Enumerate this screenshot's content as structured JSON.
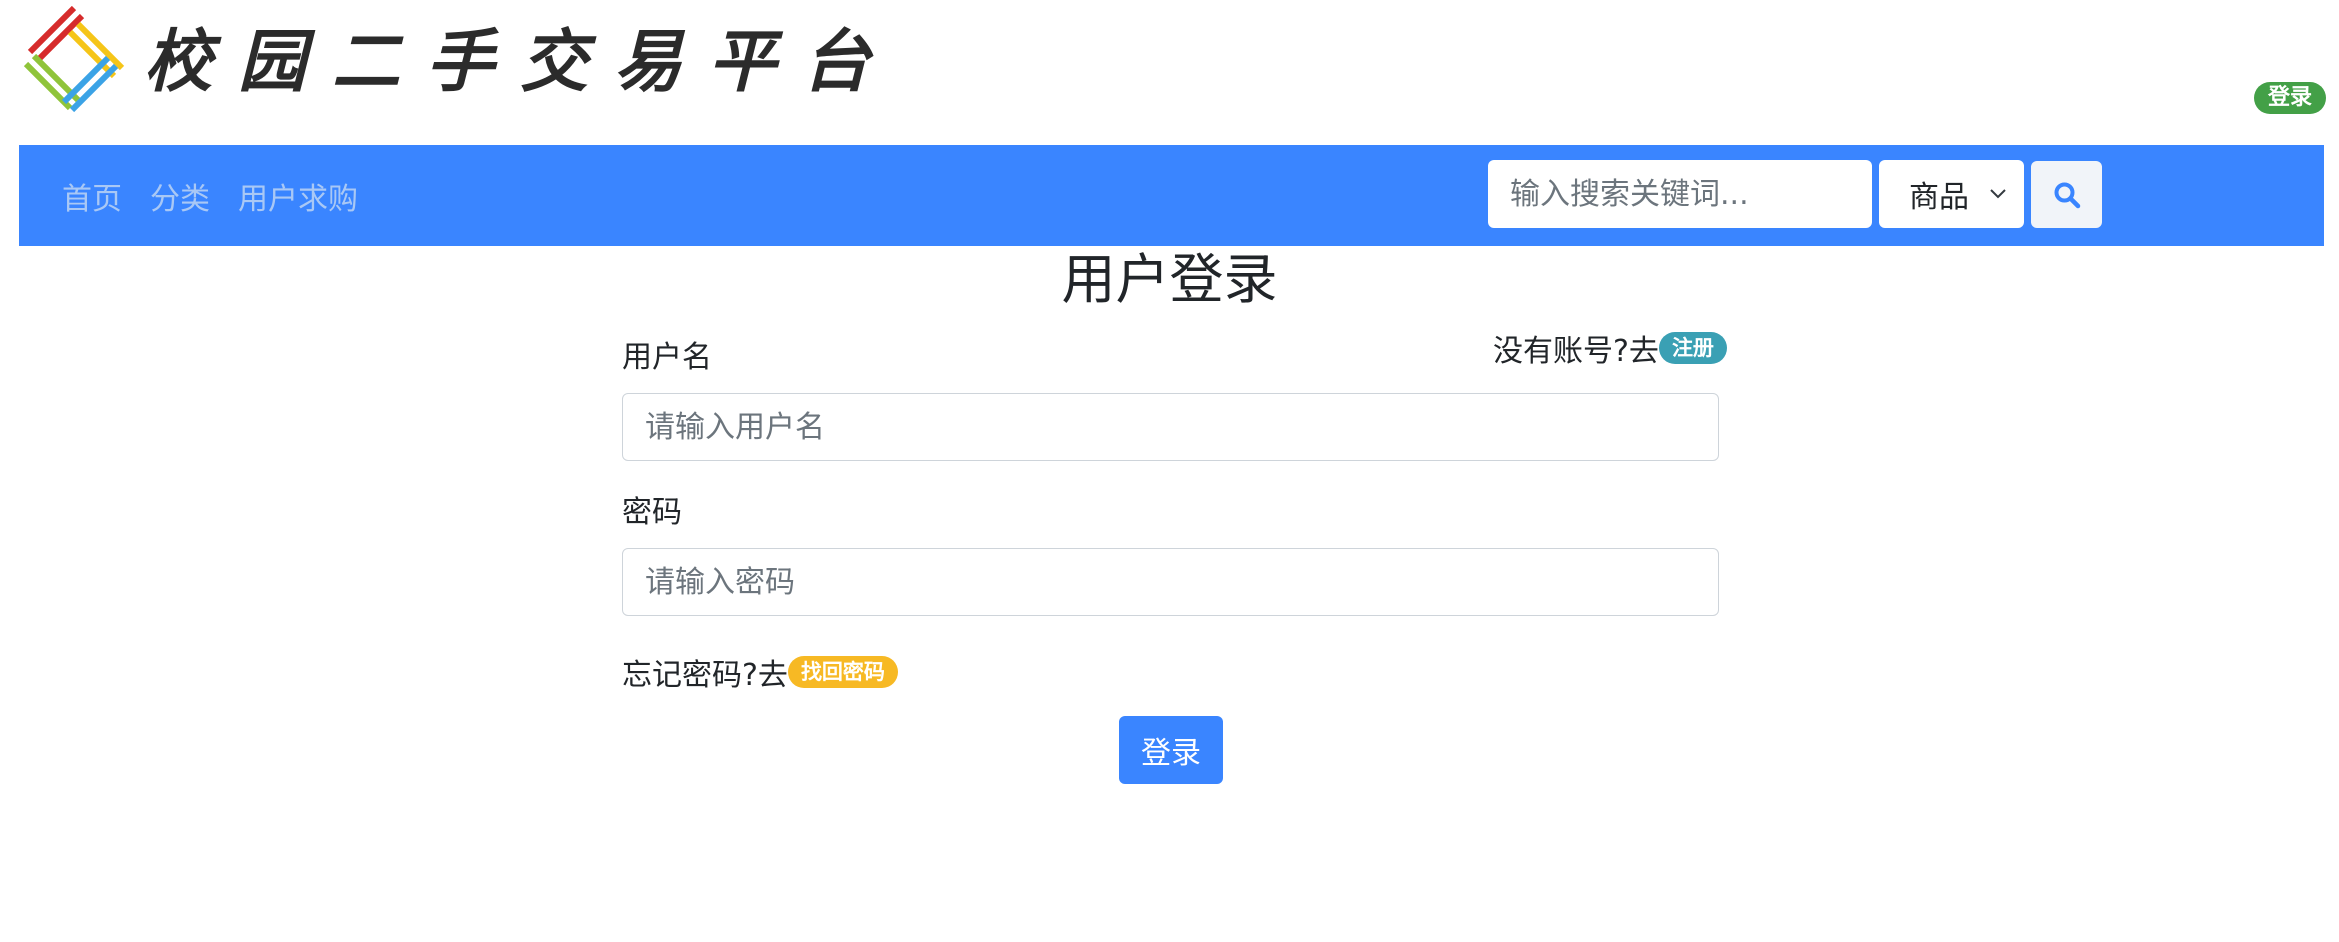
{
  "header": {
    "logo_text": "校园二手交易平台",
    "login_badge": "登录"
  },
  "nav": {
    "links": [
      {
        "label": "首页"
      },
      {
        "label": "分类"
      },
      {
        "label": "用户求购"
      }
    ],
    "search": {
      "placeholder": "输入搜索关键词...",
      "value": "",
      "select_value": "商品",
      "button_icon": "search-icon"
    }
  },
  "login_form": {
    "title": "用户登录",
    "register_prompt": "没有账号?去",
    "register_badge": "注册",
    "username_label": "用户名",
    "username_placeholder": "请输入用户名",
    "username_value": "",
    "password_label": "密码",
    "password_placeholder": "请输入密码",
    "password_value": "",
    "forgot_prompt": "忘记密码?去",
    "forgot_badge": "找回密码",
    "submit_label": "登录"
  },
  "colors": {
    "navbar": "#3a85ff",
    "nav_link": "#a9c8f5",
    "login_badge": "#43a047",
    "register_badge": "#3aa0b4",
    "forgot_badge": "#f7b924",
    "submit_button": "#3a85ff"
  }
}
